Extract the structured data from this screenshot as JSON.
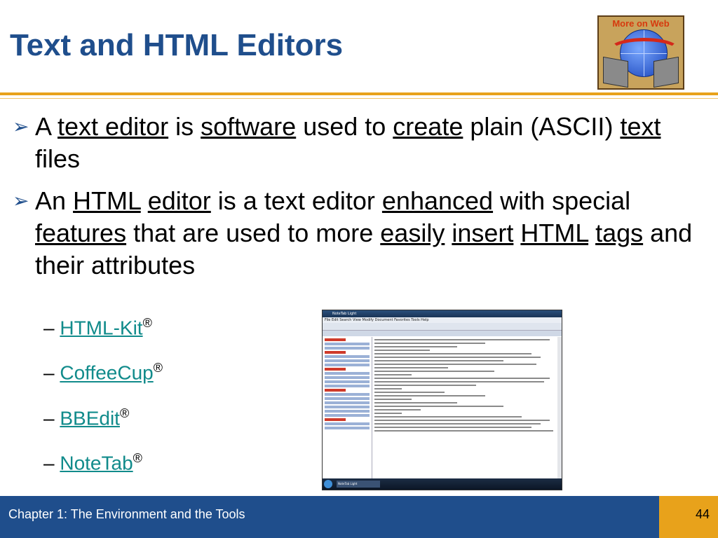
{
  "slide": {
    "title": "Text and HTML Editors",
    "web_icon_label": "More on Web"
  },
  "bullets": [
    {
      "mark": "➢",
      "segments": [
        {
          "text": "A ",
          "u": false
        },
        {
          "text": "text editor",
          "u": true
        },
        {
          "text": " is ",
          "u": false
        },
        {
          "text": "software",
          "u": true
        },
        {
          "text": " used to ",
          "u": false
        },
        {
          "text": "create",
          "u": true
        },
        {
          "text": " plain (ASCII) ",
          "u": false
        },
        {
          "text": "text",
          "u": true
        },
        {
          "text": " files",
          "u": false
        }
      ]
    },
    {
      "mark": "➢",
      "segments": [
        {
          "text": "An ",
          "u": false
        },
        {
          "text": "HTML",
          "u": true
        },
        {
          "text": " ",
          "u": false
        },
        {
          "text": "editor",
          "u": true
        },
        {
          "text": " is a text editor ",
          "u": false
        },
        {
          "text": "enhanced",
          "u": true
        },
        {
          "text": " with special ",
          "u": false
        },
        {
          "text": "features",
          "u": true
        },
        {
          "text": " that are used to more ",
          "u": false
        },
        {
          "text": "easily",
          "u": true
        },
        {
          "text": " ",
          "u": false
        },
        {
          "text": "insert",
          "u": true
        },
        {
          "text": " ",
          "u": false
        },
        {
          "text": "HTML",
          "u": true
        },
        {
          "text": " ",
          "u": false
        },
        {
          "text": "tags",
          "u": true
        },
        {
          "text": " and their attributes",
          "u": false
        }
      ]
    }
  ],
  "editors": [
    {
      "dash": "–",
      "name": "HTML-Kit",
      "reg": "®"
    },
    {
      "dash": "–",
      "name": "CoffeeCup",
      "reg": "®"
    },
    {
      "dash": "–",
      "name": "BBEdit",
      "reg": "®"
    },
    {
      "dash": "–",
      "name": "NoteTab",
      "reg": "®"
    }
  ],
  "screenshot": {
    "window_title": "NoteTab Light",
    "menu": "File  Edit  Search  View  Modify  Document  Favorites  Tools  Help",
    "taskbar_item": "NoteTab Light"
  },
  "footer": {
    "chapter": "Chapter 1: The Environment and the Tools",
    "page": "44"
  }
}
